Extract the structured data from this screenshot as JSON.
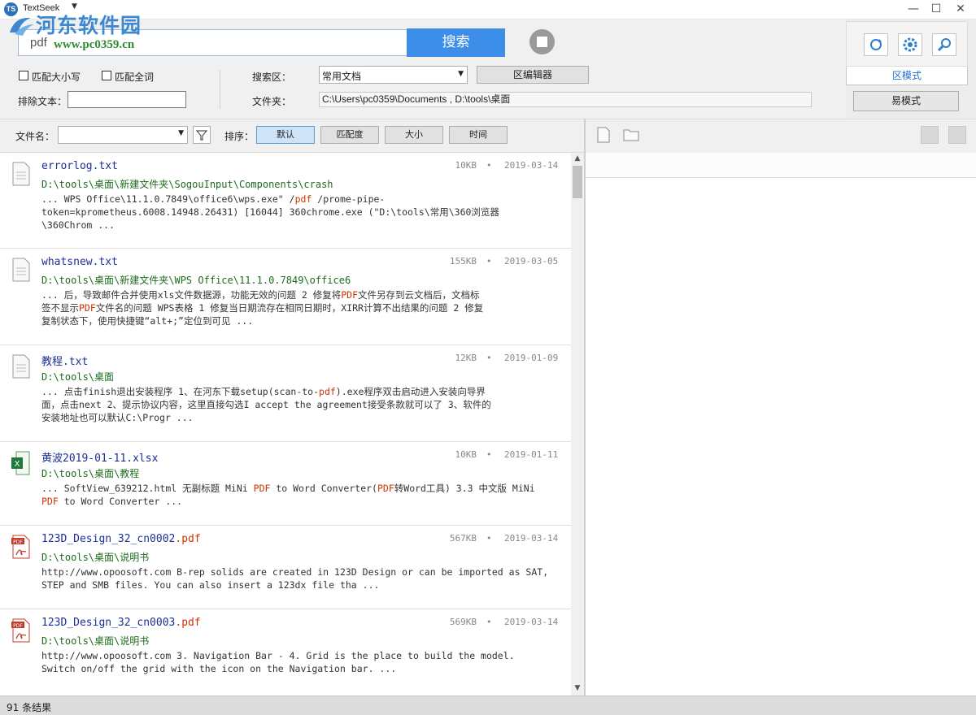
{
  "app": {
    "icon_text": "TS",
    "title": "TextSeek"
  },
  "window": {
    "minimize": "—",
    "maximize": "☐",
    "close": "✕"
  },
  "watermark": {
    "name": "河东软件园",
    "url": "www.pc0359.cn"
  },
  "search": {
    "query": "pdf",
    "button": "搜索"
  },
  "options": {
    "match_case": "匹配大小写",
    "match_whole": "匹配全词",
    "exclude_label": "排除文本：",
    "exclude_value": ""
  },
  "scope": {
    "label": "搜索区：",
    "selected": "常用文档",
    "edit_button": "区编辑器",
    "folder_label": "文件夹：",
    "folder_value": "C:\\Users\\pc0359\\Documents , D:\\tools\\桌面"
  },
  "modes": {
    "zone_mode": "区模式",
    "easy_mode": "易模式"
  },
  "filter": {
    "filename_label": "文件名：",
    "filename_value": "",
    "sort_label": "排序：",
    "sort_buttons": [
      "默认",
      "匹配度",
      "大小",
      "时间"
    ],
    "active_sort": "默认"
  },
  "results": [
    {
      "name": "errorlog.txt",
      "ext": "",
      "type": "txt",
      "size": "10KB",
      "date": "2019-03-14",
      "path": "D:\\tools\\桌面\\新建文件夹\\SogouInput\\Components\\crash",
      "snippet": [
        "... WPS Office\\11.1.0.7849\\office6\\wps.exe\" /pdf /prome-pipe-",
        "token=kprometheus.6008.14948.26431) [16044] 360chrome.exe (\"D:\\tools\\常用\\360浏览器",
        "\\360Chrom ..."
      ]
    },
    {
      "name": "whatsnew.txt",
      "ext": "",
      "type": "txt",
      "size": "155KB",
      "date": "2019-03-05",
      "path": "D:\\tools\\桌面\\新建文件夹\\WPS Office\\11.1.0.7849\\office6",
      "snippet": [
        "... 后，导致邮件合并使用xls文件数据源，功能无效的问题 2 修复将PDF文件另存到云文档后，文档标",
        "签不显示PDF文件名的问题 WPS表格 1 修复当日期流存在相同日期时，XIRR计算不出结果的问题 2 修复",
        "复制状态下，使用快捷键“alt+;”定位到可见 ..."
      ]
    },
    {
      "name": "教程.txt",
      "ext": "",
      "type": "txt",
      "size": "12KB",
      "date": "2019-01-09",
      "path": "D:\\tools\\桌面",
      "snippet": [
        "... 点击finish退出安装程序 1、在河东下载setup(scan-to-pdf).exe程序双击启动进入安装向导界",
        "面，点击next 2、提示协议内容，这里直接勾选I accept the agreement接受条款就可以了 3、软件的",
        "安装地址也可以默认C:\\Progr ..."
      ]
    },
    {
      "name": "黄波2019-01-11.xlsx",
      "ext": "",
      "type": "xlsx",
      "size": "10KB",
      "date": "2019-01-11",
      "path": "D:\\tools\\桌面\\教程",
      "snippet": [
        "... SoftView_639212.html 无副标题 MiNi PDF to Word Converter(PDF转Word工具) 3.3 中文版 MiNi",
        "PDF to Word Converter ..."
      ]
    },
    {
      "name": "123D_Design_32_cn0002",
      "ext": ".pdf",
      "type": "pdf",
      "size": "567KB",
      "date": "2019-03-14",
      "path": "D:\\tools\\桌面\\说明书",
      "snippet": [
        "http://www.opoosoft.com B-rep solids are created in 123D Design or can be imported as SAT,",
        "STEP and SMB files. You can also insert a 123dx file tha ..."
      ]
    },
    {
      "name": "123D_Design_32_cn0003",
      "ext": ".pdf",
      "type": "pdf",
      "size": "569KB",
      "date": "2019-03-14",
      "path": "D:\\tools\\桌面\\说明书",
      "snippet": [
        "http://www.opoosoft.com 3. Navigation Bar - 4. Grid is the place to build the model.",
        "Switch on/off the grid with the icon on the Navigation bar. ..."
      ]
    }
  ],
  "status": {
    "text": "91 条结果"
  },
  "colors": {
    "accent": "#3d8ee8",
    "link": "#1b2f96",
    "path": "#1d6b1d",
    "highlight": "#cc3300"
  }
}
